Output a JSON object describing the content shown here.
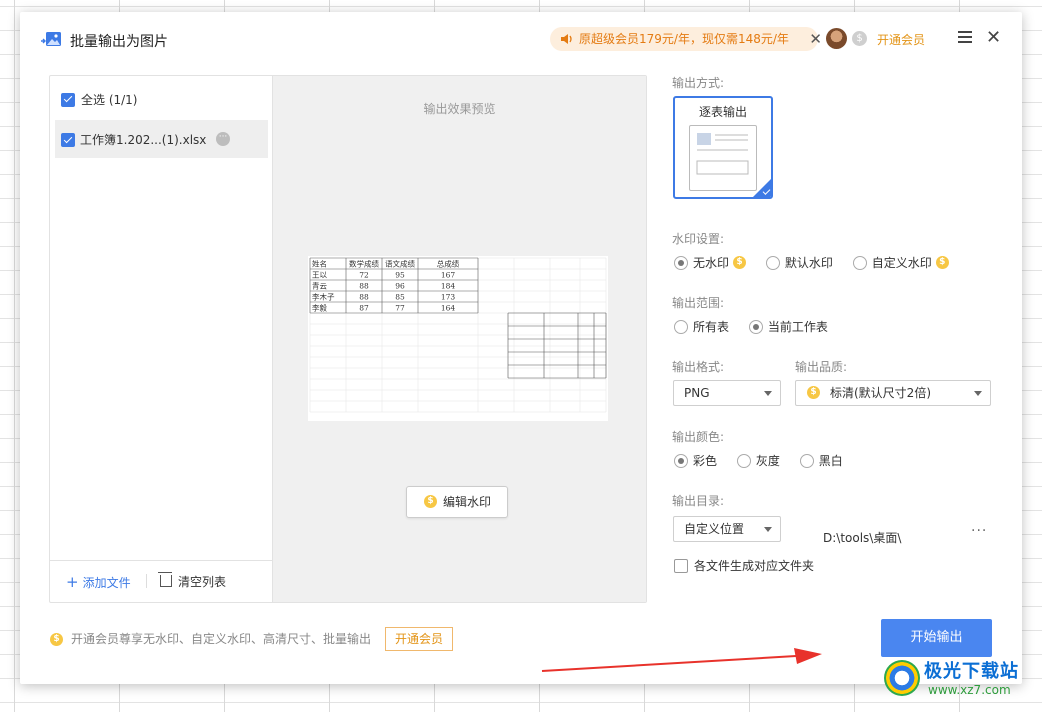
{
  "dialog": {
    "title": "批量输出为图片",
    "promo_text": "原超级会员179元/年，现仅需148元/年",
    "promo_close": "✕",
    "open_vip_top": "开通会员",
    "close": "✕"
  },
  "file_list": {
    "select_all": "全选 (1/1)",
    "files": [
      {
        "name": "工作簿1.202...(1).xlsx",
        "checked": true
      }
    ],
    "more": "···",
    "add_file": "添加文件",
    "clear_list": "清空列表"
  },
  "preview": {
    "title": "输出效果预览",
    "table_headers": [
      "姓名",
      "数学成绩",
      "语文成绩",
      "总成绩"
    ],
    "table_rows": [
      [
        "王以",
        "72",
        "95",
        "167"
      ],
      [
        "青云",
        "88",
        "96",
        "184"
      ],
      [
        "李木子",
        "88",
        "85",
        "173"
      ],
      [
        "李毅",
        "87",
        "77",
        "164"
      ]
    ],
    "edit_watermark": "编辑水印"
  },
  "settings": {
    "output_mode_label": "输出方式:",
    "output_mode_card": "逐表输出",
    "watermark_label": "水印设置:",
    "watermark_options": [
      "无水印",
      "默认水印",
      "自定义水印"
    ],
    "watermark_selected": "无水印",
    "range_label": "输出范围:",
    "range_options": [
      "所有表",
      "当前工作表"
    ],
    "range_selected": "当前工作表",
    "format_label": "输出格式:",
    "format_value": "PNG",
    "quality_label": "输出品质:",
    "quality_value": "标清(默认尺寸2倍)",
    "color_label": "输出颜色:",
    "color_options": [
      "彩色",
      "灰度",
      "黑白"
    ],
    "color_selected": "彩色",
    "dir_label": "输出目录:",
    "dir_mode": "自定义位置",
    "dir_path": "D:\\tools\\桌面\\",
    "dir_more": "···",
    "folder_per_file": "各文件生成对应文件夹",
    "folder_per_file_checked": false
  },
  "footer": {
    "tip": "开通会员尊享无水印、自定义水印、高清尺寸、批量输出",
    "vip_button": "开通会员",
    "start_button": "开始输出"
  },
  "watermark_logo": {
    "name": "极光下载站",
    "url": "www.xz7.com"
  },
  "colors": {
    "accent": "#3d7ae5",
    "start_button": "#4a86f0",
    "promo_bg": "#fdeedd",
    "promo_text": "#e47b12",
    "vip_gold": "#e39417",
    "arrow": "#e8322b"
  },
  "icons": {
    "app": "image-export-icon",
    "promo": "speaker-icon",
    "coin": "vip-coin-icon",
    "menu": "hamburger-menu-icon",
    "close": "close-icon"
  }
}
